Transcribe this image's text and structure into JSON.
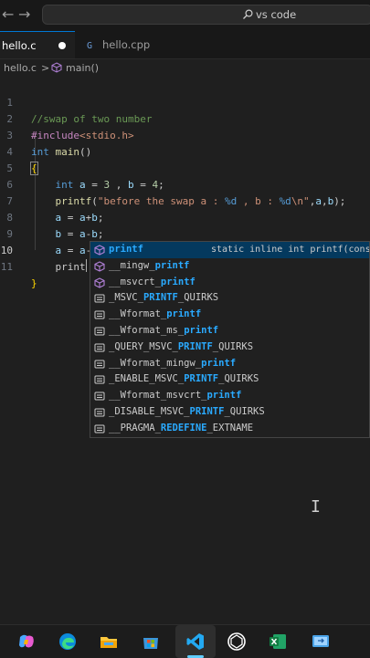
{
  "titlebar": {
    "search_text": "vs code",
    "icons": [
      "arrow-left-icon",
      "arrow-right-icon",
      "search-icon"
    ]
  },
  "tabs": [
    {
      "label": "hello.c",
      "active": true,
      "dirty": true
    },
    {
      "label": "hello.cpp",
      "active": false
    }
  ],
  "breadcrumb": {
    "file": "hello.c",
    "separator": ">",
    "symbol": "main()"
  },
  "editor": {
    "line_numbers": [
      "1",
      "2",
      "3",
      "4",
      "5",
      "6",
      "7",
      "8",
      "9",
      "10",
      "11"
    ],
    "current_line": "10",
    "typed": "print"
  },
  "suggest": {
    "items": [
      {
        "pre": "",
        "hl": "printf",
        "post": "",
        "kind": "method",
        "selected": true
      },
      {
        "pre": "__mingw_",
        "hl": "printf",
        "post": "",
        "kind": "method"
      },
      {
        "pre": "__msvcrt_",
        "hl": "printf",
        "post": "",
        "kind": "method"
      },
      {
        "pre": "_MSVC_",
        "hl": "PRINTF",
        "post": "_QUIRKS",
        "kind": "constant"
      },
      {
        "pre": "__Wformat_",
        "hl": "printf",
        "post": "",
        "kind": "constant"
      },
      {
        "pre": "__Wformat_ms_",
        "hl": "printf",
        "post": "",
        "kind": "constant"
      },
      {
        "pre": "_QUERY_MSVC_",
        "hl": "PRINTF",
        "post": "_QUIRKS",
        "kind": "constant"
      },
      {
        "pre": "__Wformat_mingw_",
        "hl": "printf",
        "post": "",
        "kind": "constant"
      },
      {
        "pre": "_ENABLE_MSVC_",
        "hl": "PRINTF",
        "post": "_QUIRKS",
        "kind": "constant"
      },
      {
        "pre": "__Wformat_msvcrt_",
        "hl": "printf",
        "post": "",
        "kind": "constant"
      },
      {
        "pre": "_DISABLE_MSVC_",
        "hl": "PRINTF",
        "post": "_QUIRKS",
        "kind": "constant"
      },
      {
        "pre": "__PRAGMA_",
        "hl": "REDEFINE",
        "post": "_EXTNAME",
        "kind": "constant"
      }
    ],
    "selected_detail": "static inline int printf(cons"
  },
  "taskbar": {
    "apps": [
      "copilot-icon",
      "edge-icon",
      "file-explorer-icon",
      "store-icon",
      "vscode-icon",
      "chatgpt-icon",
      "excel-icon",
      "remote-desktop-icon"
    ],
    "active_app": "vscode-icon"
  },
  "colors": {
    "accent": "#0078d4",
    "selection": "#04395e",
    "match_highlight": "#2aaaff"
  }
}
